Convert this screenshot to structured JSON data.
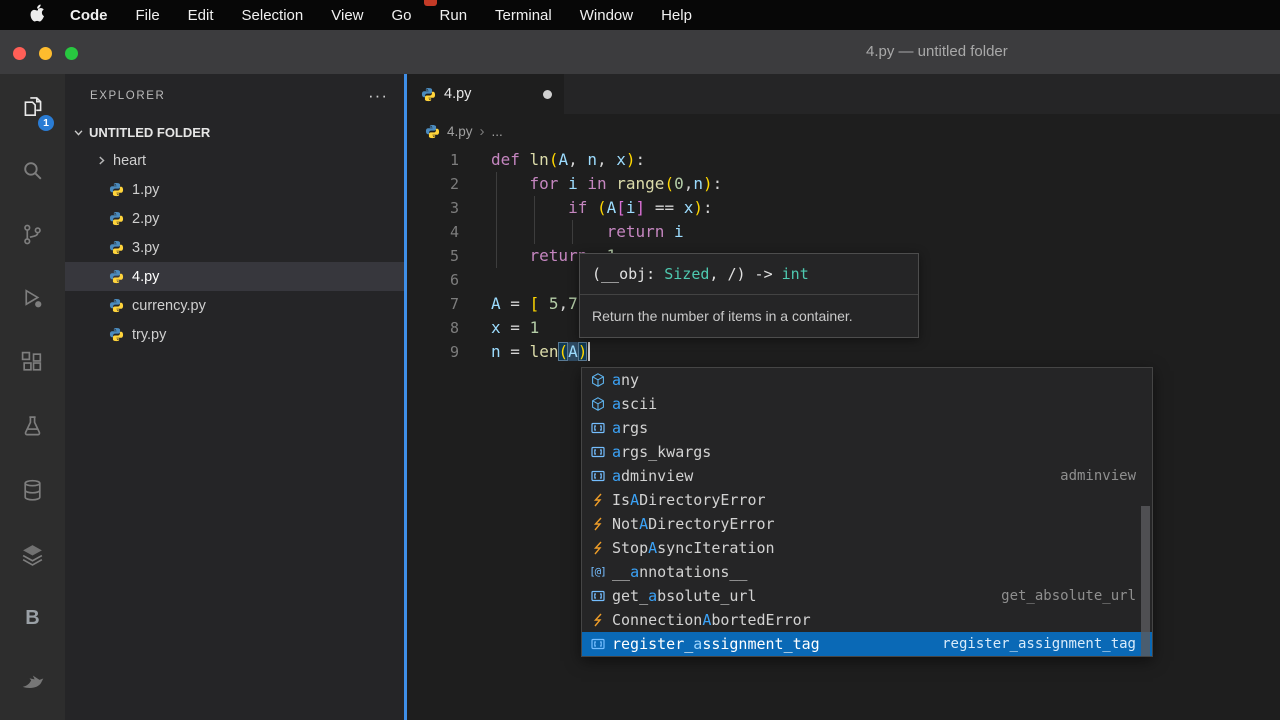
{
  "colors": {
    "accent_blue": "#3f8fe8",
    "selection_blue": "#0a69b6",
    "match_blue": "#3ba3f8",
    "badge_blue": "#2a7cd4",
    "class_icon_orange": "#ee9d28",
    "symbol_icon_blue": "#75beff"
  },
  "menu_bar": {
    "items": [
      "Code",
      "File",
      "Edit",
      "Selection",
      "View",
      "Go",
      "Run",
      "Terminal",
      "Window",
      "Help"
    ]
  },
  "title_bar": {
    "title": "4.py — untitled folder"
  },
  "activity_bar": {
    "icons": [
      {
        "name": "explorer",
        "active": true,
        "badge": "1"
      },
      {
        "name": "search"
      },
      {
        "name": "source-control"
      },
      {
        "name": "run-debug"
      },
      {
        "name": "extensions"
      },
      {
        "name": "testing"
      },
      {
        "name": "database"
      },
      {
        "name": "layers"
      },
      {
        "name": "letter-b",
        "glyph": "B"
      },
      {
        "name": "bird"
      }
    ]
  },
  "sidebar": {
    "header": "EXPLORER",
    "actions": "···",
    "section": "UNTITLED FOLDER",
    "items": [
      {
        "label": "heart",
        "kind": "folder"
      },
      {
        "label": "1.py",
        "kind": "python"
      },
      {
        "label": "2.py",
        "kind": "python"
      },
      {
        "label": "3.py",
        "kind": "python"
      },
      {
        "label": "4.py",
        "kind": "python",
        "selected": true
      },
      {
        "label": "currency.py",
        "kind": "python"
      },
      {
        "label": "try.py",
        "kind": "python"
      }
    ]
  },
  "editor": {
    "tab_label": "4.py",
    "tab_modified": true,
    "breadcrumb_file": "4.py",
    "breadcrumb_more": "..."
  },
  "code_lines": [
    {
      "n": "1",
      "tokens": [
        [
          "def",
          "kw"
        ],
        [
          " ",
          "txt"
        ],
        [
          "ln",
          "fn"
        ],
        [
          "(",
          "br"
        ],
        [
          "A",
          "var"
        ],
        [
          ", ",
          "txt"
        ],
        [
          "n",
          "var"
        ],
        [
          ", ",
          "txt"
        ],
        [
          "x",
          "var"
        ],
        [
          ")",
          "br"
        ],
        [
          ":",
          "txt"
        ]
      ]
    },
    {
      "n": "2",
      "tokens": [
        [
          "    ",
          "txt"
        ],
        [
          "for",
          "kw"
        ],
        [
          " ",
          "txt"
        ],
        [
          "i",
          "var"
        ],
        [
          " ",
          "txt"
        ],
        [
          "in",
          "kw"
        ],
        [
          " ",
          "txt"
        ],
        [
          "range",
          "fn"
        ],
        [
          "(",
          "br"
        ],
        [
          "0",
          "num"
        ],
        [
          ",",
          "txt"
        ],
        [
          "n",
          "var"
        ],
        [
          ")",
          "br"
        ],
        [
          ":",
          "txt"
        ]
      ]
    },
    {
      "n": "3",
      "tokens": [
        [
          "        ",
          "txt"
        ],
        [
          "if",
          "kw"
        ],
        [
          " ",
          "txt"
        ],
        [
          "(",
          "br"
        ],
        [
          "A",
          "var"
        ],
        [
          "[",
          "br2"
        ],
        [
          "i",
          "var"
        ],
        [
          "]",
          "br2"
        ],
        [
          " ",
          "txt"
        ],
        [
          "==",
          "op"
        ],
        [
          " ",
          "txt"
        ],
        [
          "x",
          "var"
        ],
        [
          ")",
          "br"
        ],
        [
          ":",
          "txt"
        ]
      ]
    },
    {
      "n": "4",
      "tokens": [
        [
          "            ",
          "txt"
        ],
        [
          "return",
          "kw"
        ],
        [
          " ",
          "txt"
        ],
        [
          "i",
          "var"
        ]
      ]
    },
    {
      "n": "5",
      "tokens": [
        [
          "    ",
          "txt"
        ],
        [
          "return",
          "kw"
        ],
        [
          " ",
          "txt"
        ],
        [
          "-",
          "op"
        ],
        [
          "1",
          "num"
        ]
      ]
    },
    {
      "n": "6",
      "tokens": []
    },
    {
      "n": "7",
      "tokens": [
        [
          "A",
          "var"
        ],
        [
          " ",
          "txt"
        ],
        [
          "=",
          "op"
        ],
        [
          " ",
          "txt"
        ],
        [
          "[",
          "br"
        ],
        [
          " ",
          "txt"
        ],
        [
          "5",
          "num"
        ],
        [
          ",",
          "txt"
        ],
        [
          "7",
          "num"
        ]
      ]
    },
    {
      "n": "8",
      "tokens": [
        [
          "x",
          "var"
        ],
        [
          " ",
          "txt"
        ],
        [
          "=",
          "op"
        ],
        [
          " ",
          "txt"
        ],
        [
          "1",
          "num"
        ]
      ]
    },
    {
      "n": "9",
      "tokens": [
        [
          "n",
          "var"
        ],
        [
          " ",
          "txt"
        ],
        [
          "=",
          "op"
        ],
        [
          " ",
          "txt"
        ],
        [
          "len",
          "fn"
        ],
        [
          "(",
          "brm"
        ],
        [
          "A",
          "var hl"
        ],
        [
          ")",
          "brm"
        ]
      ],
      "caret": true
    }
  ],
  "hover": {
    "signature_tokens": [
      [
        "(__obj: ",
        "txt"
      ],
      [
        "Sized",
        "type"
      ],
      [
        ", /) -> ",
        "txt"
      ],
      [
        "int",
        "type"
      ]
    ],
    "description": "Return the number of items in a container."
  },
  "suggest_items": [
    {
      "kind": "module",
      "pre": "",
      "match": "a",
      "post": "ny"
    },
    {
      "kind": "module",
      "pre": "",
      "match": "a",
      "post": "scii"
    },
    {
      "kind": "variable",
      "pre": "",
      "match": "a",
      "post": "rgs"
    },
    {
      "kind": "variable",
      "pre": "",
      "match": "a",
      "post": "rgs_kwargs"
    },
    {
      "kind": "variable",
      "pre": "",
      "match": "a",
      "post": "dminview",
      "detail": "adminview"
    },
    {
      "kind": "class",
      "pre": "Is",
      "match": "A",
      "post": "DirectoryError"
    },
    {
      "kind": "class",
      "pre": "Not",
      "match": "A",
      "post": "DirectoryError"
    },
    {
      "kind": "class",
      "pre": "Stop",
      "match": "A",
      "post": "syncIteration"
    },
    {
      "kind": "annotation",
      "pre": "__",
      "match": "a",
      "post": "nnotations__"
    },
    {
      "kind": "variable",
      "pre": "get_",
      "match": "a",
      "post": "bsolute_url",
      "detail": "get_absolute_url"
    },
    {
      "kind": "class",
      "pre": "Connection",
      "match": "A",
      "post": "bortedError"
    },
    {
      "kind": "variable",
      "pre": "register_",
      "match": "a",
      "post": "ssignment_tag",
      "detail": "register_assignment_tag",
      "selected": true
    }
  ]
}
